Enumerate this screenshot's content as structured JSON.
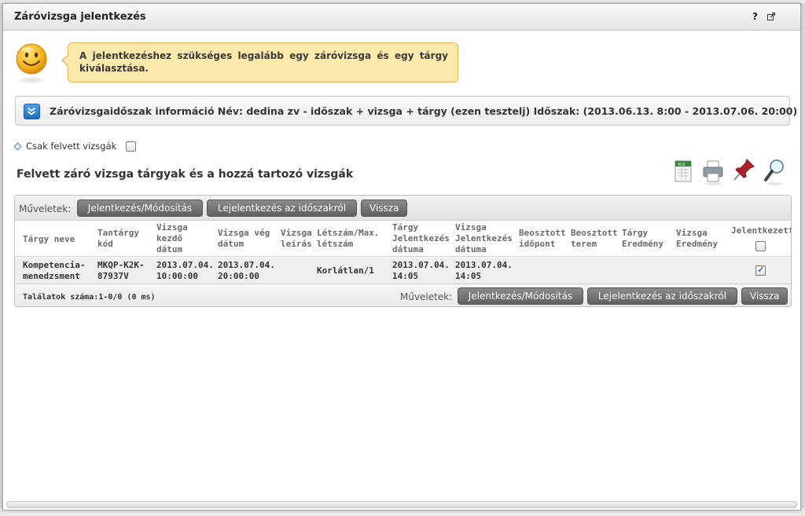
{
  "dialog": {
    "title": "Záróvizsga jelentkezés",
    "help_label": "?",
    "popout_icon": "popout-icon"
  },
  "notice": {
    "icon": "smiley-icon",
    "text": "A jelentkezéshez szükséges legalább egy záróvizsga és egy tárgy kiválasztása."
  },
  "info": {
    "toggle_icon": "chevron-double-down-icon",
    "text": "Záróvizsgaidőszak információ Név: dedina zv - időszak + vizsga + tárgy (ezen tesztelj) Időszak: (2013.06.13. 8:00 - 2013.07.06. 20:00)"
  },
  "filter": {
    "label": "Csak felvett vizsgák",
    "checked": false
  },
  "section": {
    "title": "Felvett záró vizsga tárgyak és a hozzá tartozó vizsgák",
    "tools": [
      "excel-export-icon",
      "print-icon",
      "pin-icon",
      "search-icon"
    ]
  },
  "toolbar": {
    "ops_label": "Műveletek:",
    "register_btn": "Jelentkezés/Módosítás",
    "unregister_btn": "Lejelentkezés az időszakról",
    "back_btn": "Vissza"
  },
  "table": {
    "columns": [
      "Tárgy neve",
      "Tantárgy kód",
      "Vizsga kezdő dátum",
      "Vizsga vég dátum",
      "Vizsga leírás",
      "Létszám/Max. létszám",
      "Tárgy Jelentkezés dátuma",
      "Vizsga Jelentkezés dátuma",
      "Beosztott időpont",
      "Beosztott terem",
      "Tárgy Eredmény",
      "Vizsga Eredmény",
      "Jelentkezett"
    ],
    "header_checkbox_checked": false,
    "rows": [
      {
        "subject_name": "Kompetencia-menedzsment",
        "subject_code": "MKQP-K2K-87937V",
        "exam_start": "2013.07.04. 10:00:00",
        "exam_end": "2013.07.04. 20:00:00",
        "exam_desc": "",
        "headcount": "Korlátlan/1",
        "subject_reg_date": "2013.07.04. 14:05",
        "exam_reg_date": "2013.07.04. 14:05",
        "assigned_time": "",
        "assigned_room": "",
        "subject_result": "",
        "exam_result": "",
        "registered": true
      }
    ],
    "results_text": "Találatok száma:1-0/0 (0 ms)"
  }
}
